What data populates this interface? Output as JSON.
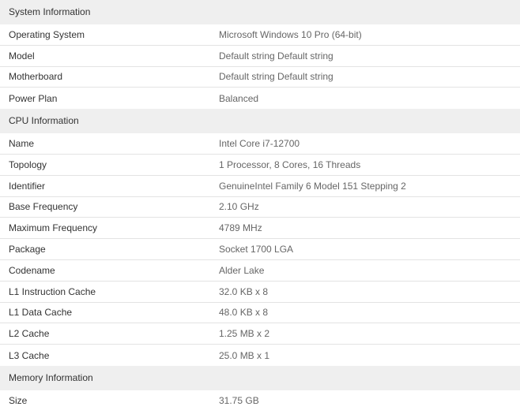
{
  "sections": [
    {
      "title": "System Information",
      "rows": [
        {
          "label": "Operating System",
          "value": "Microsoft Windows 10 Pro (64-bit)"
        },
        {
          "label": "Model",
          "value": "Default string Default string"
        },
        {
          "label": "Motherboard",
          "value": "Default string Default string"
        },
        {
          "label": "Power Plan",
          "value": "Balanced"
        }
      ]
    },
    {
      "title": "CPU Information",
      "rows": [
        {
          "label": "Name",
          "value": "Intel Core i7-12700"
        },
        {
          "label": "Topology",
          "value": "1 Processor, 8 Cores, 16 Threads"
        },
        {
          "label": "Identifier",
          "value": "GenuineIntel Family 6 Model 151 Stepping 2"
        },
        {
          "label": "Base Frequency",
          "value": "2.10 GHz"
        },
        {
          "label": "Maximum Frequency",
          "value": "4789 MHz"
        },
        {
          "label": "Package",
          "value": "Socket 1700 LGA"
        },
        {
          "label": "Codename",
          "value": "Alder Lake"
        },
        {
          "label": "L1 Instruction Cache",
          "value": "32.0 KB x 8"
        },
        {
          "label": "L1 Data Cache",
          "value": "48.0 KB x 8"
        },
        {
          "label": "L2 Cache",
          "value": "1.25 MB x 2"
        },
        {
          "label": "L3 Cache",
          "value": "25.0 MB x 1"
        }
      ]
    },
    {
      "title": "Memory Information",
      "rows": [
        {
          "label": "Size",
          "value": "31.75 GB"
        }
      ]
    }
  ]
}
